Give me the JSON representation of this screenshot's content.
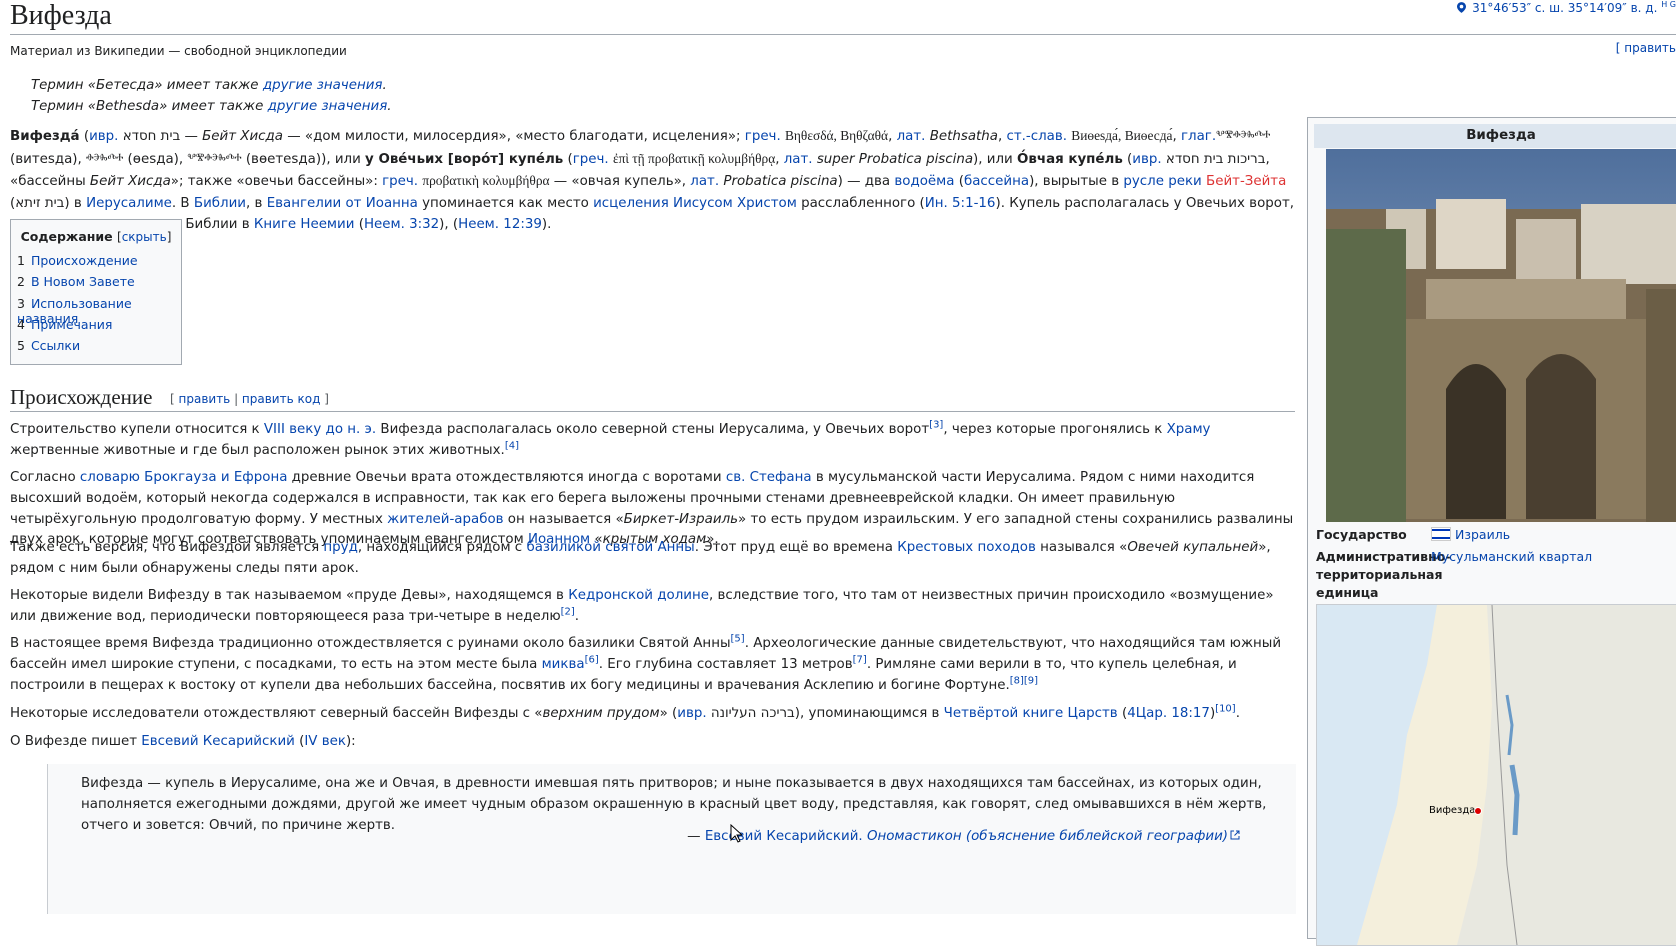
{
  "page": {
    "title": "Вифезда",
    "coords": "31°46′53″ с. ш. 35°14′09″ в. д.",
    "coords_tail": "H G",
    "tagline": "Материал из Википедии — свободной энциклопедии",
    "edit_link": "[ править"
  },
  "hatnotes": [
    {
      "text": "Термин «Бетесда» имеет также ",
      "link": "другие значения",
      "end": "."
    },
    {
      "text": "Термин «Bethesda» имеет также ",
      "link": "другие значения",
      "end": "."
    }
  ],
  "toc": {
    "title": "Содержание",
    "toggle": "скрыть",
    "items": [
      {
        "num": "1",
        "label": "Происхождение"
      },
      {
        "num": "2",
        "label": "В Новом Завете"
      },
      {
        "num": "3",
        "label": "Использование названия"
      },
      {
        "num": "4",
        "label": "Примечания"
      },
      {
        "num": "5",
        "label": "Ссылки"
      }
    ]
  },
  "section": {
    "heading": "Происхождение",
    "edit": "править",
    "edit_code": "править код"
  },
  "infobox": {
    "title": "Вифезда",
    "state_label": "Государство",
    "state_value": "Израиль",
    "admin_label": "Административно-территориальная единица",
    "admin_value": "Мусульманский квартал",
    "map_label": "Вифезда"
  },
  "quote": {
    "text": "Вифезда — купель в Иерусалиме, она же и Овчая, в древности имевшая пять притворов; и ныне показывается в двух находящихся там бассейнах, из которых один, наполняется ежегодными дождями, другой же имеет чудным образом окрашенную в красный цвет воду, представляя, как говорят, след омывавшихся в нём жертв, отчего и зовется: Овчий, по причине жертв.",
    "dash": "— ",
    "author": "Евсевий Кесарийский.",
    "work": "Ономастикон (объяснение библейской географии)"
  },
  "colors": {
    "link": "#0645ad",
    "redlink": "#d33",
    "infobox_header": "#dde6ef"
  },
  "icons": [
    "map-pin-icon",
    "israel-flag-icon",
    "external-link-icon",
    "mouse-cursor-icon"
  ]
}
